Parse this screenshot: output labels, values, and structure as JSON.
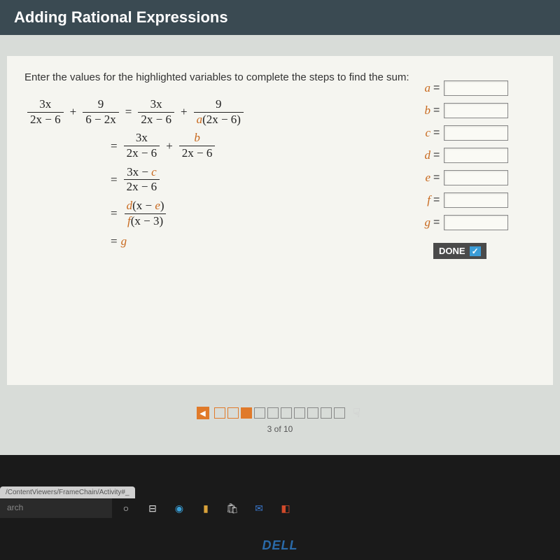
{
  "header": {
    "title": "Adding Rational Expressions"
  },
  "instructions": "Enter the values for the highlighted variables to complete the steps to find the sum:",
  "math": {
    "line1": {
      "f1n": "3x",
      "f1d": "2x − 6",
      "f2n": "9",
      "f2d": "6 − 2x",
      "f3n": "3x",
      "f3d": "2x − 6",
      "f4n": "9",
      "f4d_pre": "a",
      "f4d_expr": "(2x − 6)"
    },
    "line2": {
      "f1n": "3x",
      "f1d": "2x − 6",
      "f2n_hl": "b",
      "f2d": "2x − 6"
    },
    "line3": {
      "n_pre": "3x − ",
      "n_hl": "c",
      "d": "2x − 6"
    },
    "line4": {
      "n_hl1": "d",
      "n_mid": "(x − ",
      "n_hl2": "e",
      "n_end": ")",
      "d_hl": "f",
      "d_expr": "(x − 3)"
    },
    "line5": {
      "hl": "g"
    }
  },
  "fields": [
    {
      "label": "a"
    },
    {
      "label": "b"
    },
    {
      "label": "c"
    },
    {
      "label": "d"
    },
    {
      "label": "e"
    },
    {
      "label": "f"
    },
    {
      "label": "g"
    }
  ],
  "done": "DONE",
  "pager": {
    "text": "3 of 10"
  },
  "browser_tab": "/ContentViewers/FrameChain/Activity#_",
  "search_placeholder": "arch",
  "logo": "DELL"
}
